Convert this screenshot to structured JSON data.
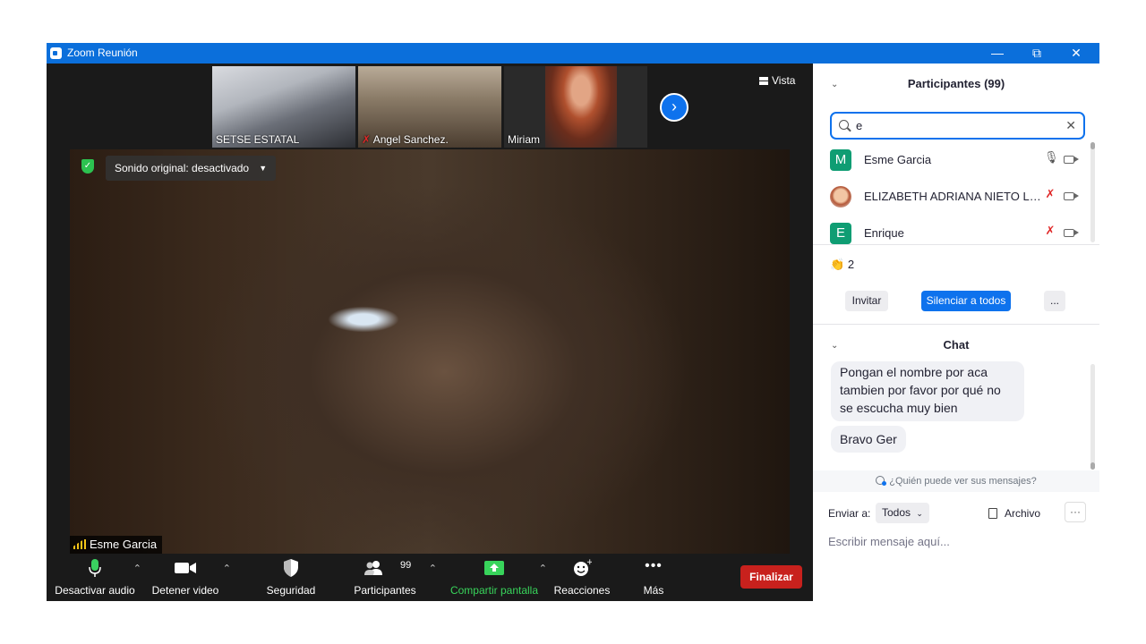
{
  "window": {
    "title": "Zoom Reunión",
    "minimize": "—",
    "maximize": "⧉",
    "close": "✕"
  },
  "thumbnails": [
    {
      "name": "SETSE ESTATAL"
    },
    {
      "name": "Angel Sanchez."
    },
    {
      "name": "Miriam"
    }
  ],
  "view_button": "Vista",
  "main_video": {
    "audio_setting": "Sonido original: desactivado",
    "speaker": "Esme Garcia"
  },
  "toolbar": {
    "audio": "Desactivar audio",
    "video": "Detener video",
    "security": "Seguridad",
    "participants": "Participantes",
    "participants_count": "99",
    "share": "Compartir pantalla",
    "reactions": "Reacciones",
    "more": "Más",
    "end": "Finalizar"
  },
  "participants_panel": {
    "title": "Participantes (99)",
    "search_value": "e",
    "rows": [
      {
        "initial": "M",
        "name": "Esme Garcia",
        "mic": "on",
        "avatar_color": "#0f9d73"
      },
      {
        "initial": "",
        "name": "ELIZABETH ADRIANA NIETO LEÓN",
        "mic": "off"
      },
      {
        "initial": "E",
        "name": "Enrique",
        "mic": "off",
        "avatar_color": "#0f9d73"
      }
    ],
    "reaction_count": "2",
    "invite": "Invitar",
    "mute_all": "Silenciar a todos",
    "more": "..."
  },
  "chat": {
    "title": "Chat",
    "messages": [
      "Pongan el nombre por aca tambien por favor por qué no se escucha muy bien",
      "Bravo Ger"
    ],
    "who_can_see": "¿Quién puede ver sus mensajes?",
    "send_to_label": "Enviar a:",
    "send_to_value": "Todos",
    "file": "Archivo",
    "more": "···",
    "placeholder": "Escribir mensaje aquí..."
  },
  "colors": {
    "accent": "#0e72ed",
    "end": "#c8211d",
    "share": "#38d45b",
    "titlebar": "#0b6fdb"
  }
}
